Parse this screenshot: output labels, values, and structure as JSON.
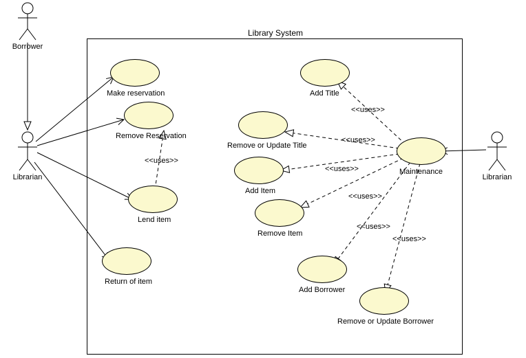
{
  "chart_data": {
    "type": "uml-use-case",
    "system": "Library System",
    "actors": [
      "Borrower",
      "Librarian",
      "Librarian"
    ],
    "use_cases": [
      "Make reservation",
      "Remove Reservation",
      "Lend item",
      "Return of item",
      "Add Title",
      "Remove or Update Title",
      "Add Item",
      "Remove Item",
      "Add Borrower",
      "Remove or Update Borrower",
      "Maintenance"
    ],
    "relations": [
      {
        "from": "Borrower",
        "to": "Librarian (left)",
        "type": "association"
      },
      {
        "from": "Librarian (left)",
        "to": "Make reservation",
        "type": "association"
      },
      {
        "from": "Librarian (left)",
        "to": "Remove Reservation",
        "type": "association"
      },
      {
        "from": "Librarian (left)",
        "to": "Lend item",
        "type": "association"
      },
      {
        "from": "Librarian (left)",
        "to": "Return of item",
        "type": "association"
      },
      {
        "from": "Lend item",
        "to": "Remove Reservation",
        "type": "uses"
      },
      {
        "from": "Librarian (right)",
        "to": "Maintenance",
        "type": "association"
      },
      {
        "from": "Maintenance",
        "to": "Add Title",
        "type": "uses"
      },
      {
        "from": "Maintenance",
        "to": "Remove or Update Title",
        "type": "uses"
      },
      {
        "from": "Maintenance",
        "to": "Add Item",
        "type": "uses"
      },
      {
        "from": "Maintenance",
        "to": "Remove Item",
        "type": "uses"
      },
      {
        "from": "Maintenance",
        "to": "Add Borrower",
        "type": "uses"
      },
      {
        "from": "Maintenance",
        "to": "Remove or Update Borrower",
        "type": "uses"
      }
    ]
  },
  "system": {
    "title": "Library System"
  },
  "actors": {
    "borrower": "Borrower",
    "librarian_left": "Librarian",
    "librarian_right": "Librarian"
  },
  "usecases": {
    "make_reservation": "Make reservation",
    "remove_reservation": "Remove Reservation",
    "lend_item": "Lend item",
    "return_item": "Return of item",
    "add_title": "Add Title",
    "remove_update_title": "Remove or Update Title",
    "add_item": "Add Item",
    "remove_item": "Remove Item",
    "add_borrower": "Add Borrower",
    "remove_update_borrower": "Remove or Update Borrower",
    "maintenance": "Maintenance"
  },
  "stereo": {
    "uses1": "<<uses>>",
    "uses2": "<<uses>>",
    "uses3": "<<uses>>",
    "uses4": "<<uses>>",
    "uses5": "<<uses>>",
    "uses6": "<<uses>>",
    "uses7": "<<uses>>"
  }
}
